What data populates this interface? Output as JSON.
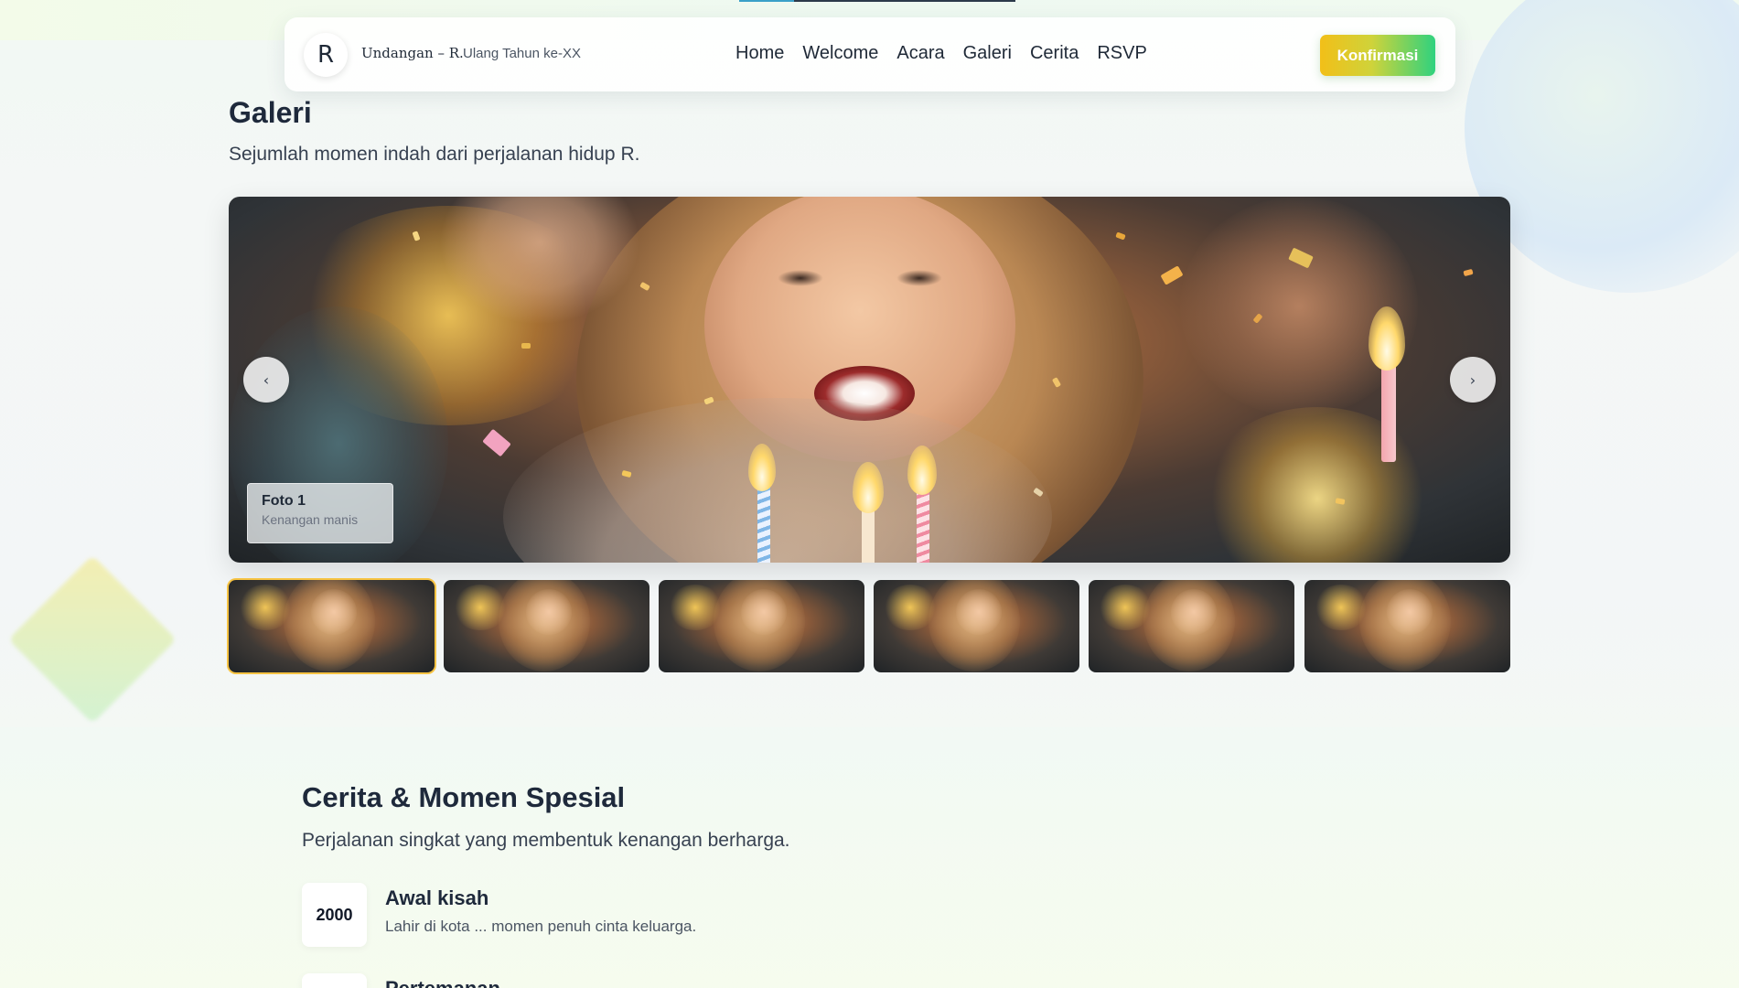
{
  "brand": {
    "logo_letter": "R",
    "name": "Undangan – R.",
    "subtitle": "Ulang Tahun ke-XX"
  },
  "nav": {
    "links": [
      "Home",
      "Welcome",
      "Acara",
      "Galeri",
      "Cerita",
      "RSVP"
    ],
    "cta_label": "Konfirmasi"
  },
  "gallery": {
    "title": "Galeri",
    "subtitle": "Sejumlah momen indah dari perjalanan hidup R.",
    "prev_icon": "‹",
    "next_icon": "›",
    "caption": {
      "title": "Foto 1",
      "description": "Kenangan manis"
    }
  },
  "story": {
    "title": "Cerita & Momen Spesial",
    "subtitle": "Perjalanan singkat yang membentuk kenangan berharga.",
    "items": [
      {
        "year": "2000",
        "title": "Awal kisah",
        "description": "Lahir di kota ... momen penuh cinta keluarga."
      },
      {
        "year": "",
        "title": "Pertemanan",
        "description": ""
      }
    ]
  },
  "colors": {
    "accent_start": "#f2bf18",
    "accent_end": "#2fd27e",
    "active_thumb_border": "#f6c343",
    "heading": "#1e293b"
  }
}
